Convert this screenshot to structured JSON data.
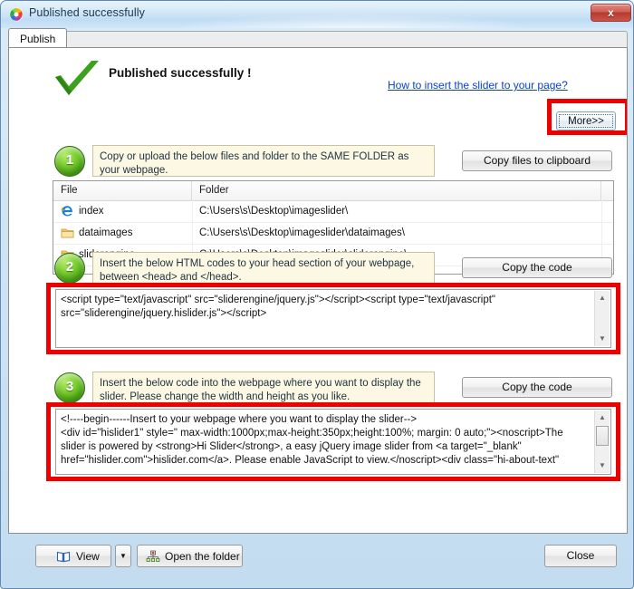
{
  "window": {
    "title": "Published successfully",
    "app_icon": "pinwheel-logo-icon",
    "close_label": "x"
  },
  "tabs": [
    {
      "label": "Publish",
      "active": true
    }
  ],
  "header": {
    "success_icon": "green-checkmark-icon",
    "title": "Published successfully !",
    "help_link": "How to insert the slider to your page?",
    "more_button": "More>>",
    "highlight_color": "#ee0000"
  },
  "step1": {
    "badge": "1",
    "instruction": "Copy or upload the below files and folder to the SAME FOLDER as your webpage.",
    "button": "Copy files to clipboard"
  },
  "file_table": {
    "columns": [
      "File",
      "Folder"
    ],
    "rows": [
      {
        "icon": "internet-explorer-icon",
        "file": "index",
        "folder": "C:\\Users\\s\\Desktop\\imageslider\\"
      },
      {
        "icon": "folder-icon",
        "file": "dataimages",
        "folder": "C:\\Users\\s\\Desktop\\imageslider\\dataimages\\"
      },
      {
        "icon": "folder-icon",
        "file": "sliderengine",
        "folder": "C:\\Users\\s\\Desktop\\imageslider\\sliderengine\\"
      }
    ]
  },
  "step2": {
    "badge": "2",
    "instruction": "Insert  the below HTML codes to your head section of your webpage, between <head> and </head>.",
    "button": "Copy the code",
    "code": "<script type=\"text/javascript\" src=\"sliderengine/jquery.js\"></script><script type=\"text/javascript\" src=\"sliderengine/jquery.hislider.js\"></script>"
  },
  "step3": {
    "badge": "3",
    "instruction": "Insert the below code into the webpage where you want to display the slider. Please change the width and height as you like.",
    "button": "Copy the code",
    "code": "<!----begin------Insert to your webpage where you want to display the slider-->\n<div id=\"hislider1\" style=\" max-width:1000px;max-height:350px;height:100%; margin: 0 auto;\"><noscript>The slider is powered by <strong>Hi Slider</strong>, a easy jQuery image slider from <a target=\"_blank\" href=\"hislider.com\">hislider.com</a>. Please enable JavaScript to view.</noscript><div class=\"hi-about-text\""
  },
  "footer": {
    "view_button": "View",
    "view_icon": "book-icon",
    "view_dropdown_icon": "triangle-down-icon",
    "open_folder_button": "Open the folder",
    "open_folder_icon": "network-folder-icon",
    "close_button": "Close"
  }
}
